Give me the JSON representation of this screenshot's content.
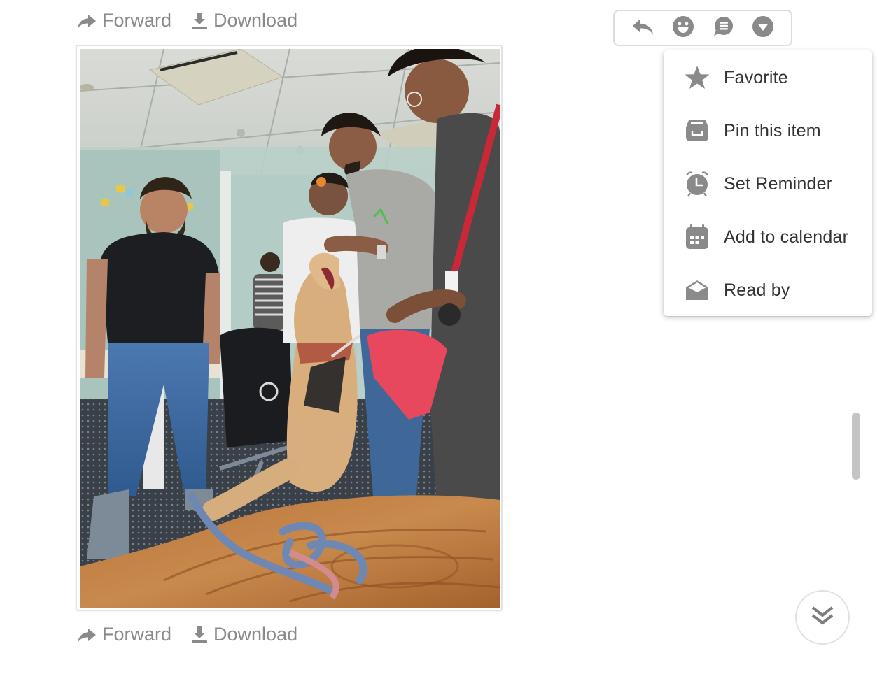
{
  "message": {
    "top_actions": {
      "forward_label": "Forward",
      "download_label": "Download"
    },
    "bottom_actions": {
      "forward_label": "Forward",
      "download_label": "Download"
    },
    "image": {
      "alt": "Group of people in an office playing with a golden retriever dog standing on its hind legs, with a leash on a wooden table"
    }
  },
  "toolbar": {
    "buttons": [
      {
        "name": "reply",
        "icon": "reply-icon"
      },
      {
        "name": "reaction",
        "icon": "smiley-icon"
      },
      {
        "name": "comment",
        "icon": "comment-icon"
      },
      {
        "name": "more",
        "icon": "caret-down-circle-icon"
      }
    ]
  },
  "menu": {
    "items": [
      {
        "label": "Favorite",
        "icon": "star-icon"
      },
      {
        "label": "Pin this item",
        "icon": "pin-tray-icon"
      },
      {
        "label": "Set Reminder",
        "icon": "alarm-clock-icon"
      },
      {
        "label": "Add to calendar",
        "icon": "calendar-icon"
      },
      {
        "label": "Read by",
        "icon": "open-envelope-icon"
      }
    ]
  },
  "scroll_to_bottom": {
    "icon": "double-chevron-down-icon"
  },
  "colors": {
    "icon_gray": "#8a8a8a",
    "menu_text": "#333333",
    "border": "#e3e3e3"
  }
}
